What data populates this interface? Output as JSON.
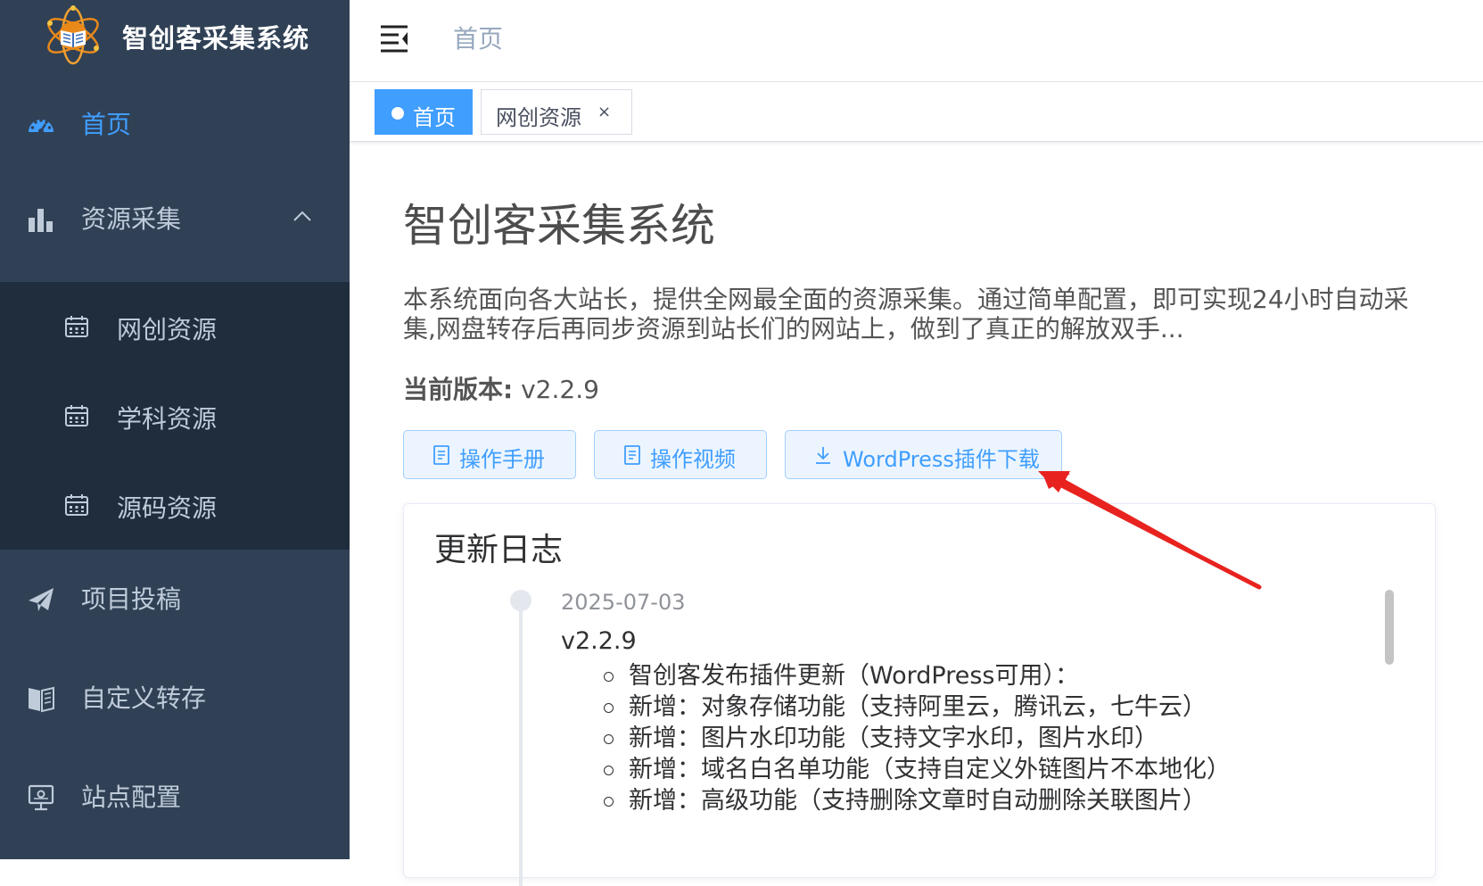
{
  "app": {
    "title": "智创客采集系统"
  },
  "sidebar": {
    "items": [
      {
        "label": "首页",
        "icon": "dashboard-icon",
        "active": true
      },
      {
        "label": "资源采集",
        "icon": "bar-chart-icon",
        "expanded": true
      },
      {
        "label": "项目投稿",
        "icon": "paper-plane-icon"
      },
      {
        "label": "自定义转存",
        "icon": "book-icon"
      },
      {
        "label": "站点配置",
        "icon": "monitor-icon"
      }
    ],
    "submenu": [
      {
        "label": "网创资源",
        "icon": "calendar-icon"
      },
      {
        "label": "学科资源",
        "icon": "calendar-icon"
      },
      {
        "label": "源码资源",
        "icon": "calendar-icon"
      }
    ]
  },
  "header": {
    "breadcrumb": "首页"
  },
  "tags": [
    {
      "label": "首页",
      "active": true
    },
    {
      "label": "网创资源",
      "closable": true,
      "close_glyph": "×"
    }
  ],
  "main": {
    "title": "智创客采集系统",
    "description": "本系统面向各大站长，提供全网最全面的资源采集。通过简单配置，即可实现24小时自动采集,网盘转存后再同步资源到站长们的网站上，做到了真正的解放双手...",
    "version_label": "当前版本:",
    "version_value": " v2.2.9",
    "buttons": {
      "manual": "操作手册",
      "video": "操作视频",
      "download": "WordPress插件下载"
    },
    "changelog": {
      "title": "更新日志",
      "entries": [
        {
          "date": "2025-07-03",
          "version": "v2.2.9",
          "items": [
            "智创客发布插件更新（WordPress可用）：",
            "新增：对象存储功能（支持阿里云，腾讯云，七牛云）",
            "新增：图片水印功能（支持文字水印，图片水印）",
            "新增：域名白名单功能（支持自定义外链图片不本地化）",
            "新增：高级功能（支持删除文章时自动删除关联图片）"
          ]
        }
      ]
    }
  },
  "colors": {
    "sidebar_bg": "#304156",
    "submenu_bg": "#1f2d3d",
    "accent": "#409eff",
    "sidebar_text": "#bfcbd9",
    "annotation_arrow": "#e8231f"
  }
}
